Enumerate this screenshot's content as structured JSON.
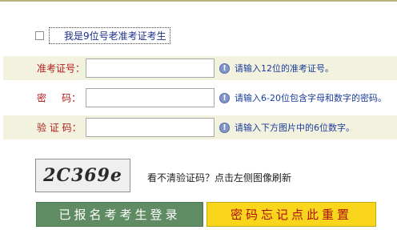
{
  "old_candidate": {
    "checkbox_checked": false,
    "label": "我是9位号老准考证考生"
  },
  "fields": [
    {
      "label": "准考证号：",
      "value": "",
      "hint": "请输入12位的准考证号。"
    },
    {
      "label": "密     码：",
      "value": "",
      "hint": "请输入6-20位包含字母和数字的密码。"
    },
    {
      "label": "验 证 码：",
      "value": "",
      "hint": "请输入下方图片中的6位数字。"
    }
  ],
  "captcha": {
    "image_text": "2C369e",
    "tip": "看不清验证码？点击左侧图像刷新"
  },
  "buttons": {
    "login": "已报名考考生登录",
    "reset": "密码忘记点此重置"
  },
  "colors": {
    "label_red": "#b31b1b",
    "hint_blue": "#1b3c9b",
    "band_shade": "#f3f2df",
    "login_green": "#5f8c62",
    "reset_yellow": "#f9d61b"
  }
}
